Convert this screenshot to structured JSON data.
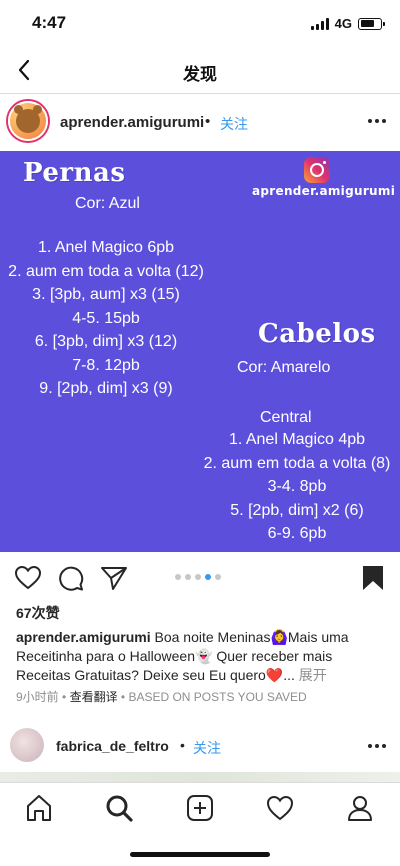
{
  "status": {
    "time": "4:47",
    "network": "4G"
  },
  "nav": {
    "title": "发现"
  },
  "post": {
    "username": "aprender.amigurumi",
    "separator": "•",
    "follow": "关注",
    "image": {
      "ig_handle": "aprender.amigurumi",
      "left_heading": "Pernas",
      "left_color": "Cor: Azul",
      "left_lines": [
        "1. Anel Magico 6pb",
        "2. aum em toda a volta (12)",
        "3. [3pb, aum] x3 (15)",
        "4-5. 15pb",
        "6. [3pb, dim] x3 (12)",
        "7-8. 12pb",
        "9. [2pb, dim] x3 (9)"
      ],
      "right_heading": "Cabelos",
      "right_color": "Cor: Amarelo",
      "right_sub": "Central",
      "right_lines": [
        "1. Anel Magico 4pb",
        "2. aum em toda a volta (8)",
        "3-4. 8pb",
        "5. [2pb, dim] x2 (6)",
        "6-9. 6pb"
      ]
    },
    "carousel": {
      "count": 5,
      "active_index": 3
    },
    "likes": "67次赞",
    "caption_user": "aprender.amigurumi",
    "caption_text": " Boa noite Meninas🙆‍♀️Mais uma Receitinha para o Halloween👻 Quer receber mais Receitas Gratuitas? Deixe seu Eu quero❤️...",
    "caption_expand": " 展开",
    "time_ago": "9小时前",
    "meta_sep": " • ",
    "translate": "查看翻译",
    "based_on": "BASED ON POSTS YOU SAVED"
  },
  "post2": {
    "username": "fabrica_de_feltro",
    "separator": "•",
    "follow": "关注"
  },
  "icons": {
    "back": "chevron-left-icon",
    "like": "heart-icon",
    "comment": "comment-icon",
    "share": "send-icon",
    "save": "bookmark-icon",
    "home": "home-icon",
    "search": "search-icon",
    "new_post": "plus-square-icon",
    "activity": "heart-icon",
    "profile": "user-icon"
  },
  "colors": {
    "accent": "#3897f0",
    "post_bg": "#5c4fdc"
  }
}
